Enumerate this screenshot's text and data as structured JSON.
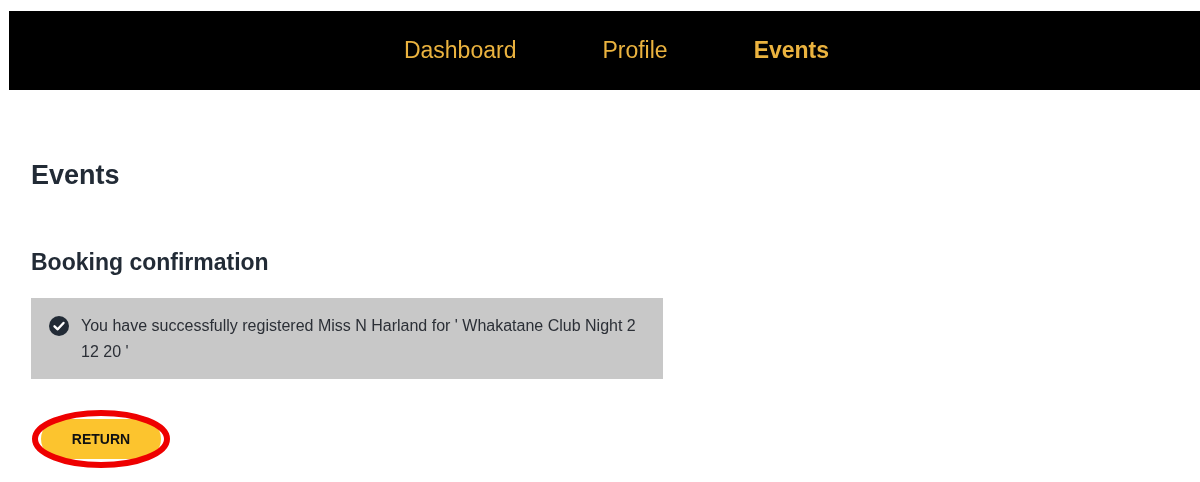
{
  "nav": {
    "items": [
      {
        "label": "Dashboard",
        "selected": false
      },
      {
        "label": "Profile",
        "selected": false
      },
      {
        "label": "Events",
        "selected": true
      }
    ]
  },
  "page_title": "Events",
  "section_title": "Booking confirmation",
  "alert": {
    "message": "You have successfully registered Miss N Harland for ' Whakatane Club Night 2 12 20 '"
  },
  "return_button": {
    "label": "RETURN",
    "highlighted": true
  }
}
